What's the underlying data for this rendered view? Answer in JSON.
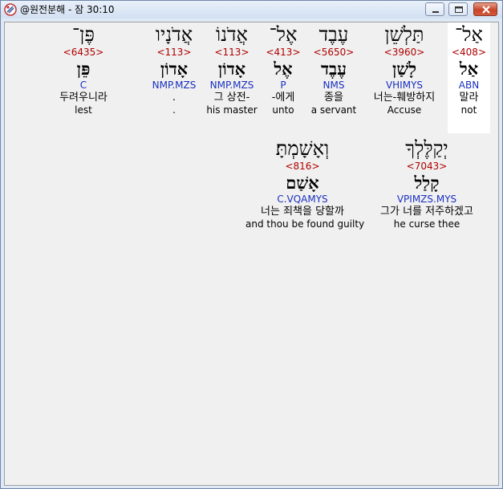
{
  "window": {
    "title": "@원전분해 - 잠 30:10"
  },
  "rows": [
    {
      "words": [
        {
          "hebrew": "אַל־",
          "strong": "<408>",
          "lemma": "אַל",
          "morph": "ABN",
          "korean": "말라",
          "english": "not",
          "selected": true
        },
        {
          "hebrew": "תַּלְשֵׁן",
          "strong": "<3960>",
          "lemma": "לָשַׁן",
          "morph": "VHIMYS",
          "korean": "너는-훼방하지",
          "english": "Accuse"
        },
        {
          "hebrew": "עֶבֶד",
          "strong": "<5650>",
          "lemma": "עֶבֶד",
          "morph": "NMS",
          "korean": "종을",
          "english": "a servant"
        },
        {
          "hebrew": "אֶל־",
          "strong": "<413>",
          "lemma": "אֶל",
          "morph": "P",
          "korean": "-에게",
          "english": "unto"
        },
        {
          "hebrew": "אֲדֹנוֹ",
          "strong": "<113>",
          "lemma": "אָדוֹן",
          "morph": "NMP.MZS",
          "korean": "그 상전-",
          "english": "his master"
        },
        {
          "hebrew": "אֲדֹנָיו",
          "strong": "<113>",
          "lemma": "אָדוֹן",
          "morph": "NMP.MZS",
          "korean": ".",
          "english": "."
        },
        {
          "hebrew": "פֶּן־",
          "strong": "<6435>",
          "lemma": "פֵּן",
          "morph": "C",
          "korean": "두려우니라",
          "english": "lest"
        }
      ]
    },
    {
      "words": [
        {
          "hebrew": "יְקַלֶּלְךָ",
          "strong": "<7043>",
          "lemma": "קָלַל",
          "morph": "VPIMZS.MYS",
          "korean": "그가 너를 저주하겠고",
          "english": "he curse thee"
        },
        {
          "hebrew": "וְאָשָׁמְתָּ׃",
          "strong": "<816>",
          "lemma": "אָשַׁם",
          "morph": "C.VQAMYS",
          "korean": "너는 죄책을 당할까",
          "english": "and thou be found guilty"
        }
      ]
    }
  ]
}
